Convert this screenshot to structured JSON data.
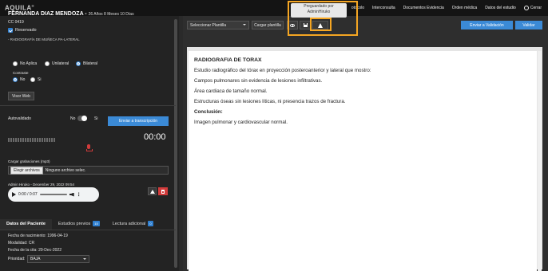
{
  "app": {
    "logo": "AQUILA",
    "logo_mark": "®"
  },
  "nav": {
    "items": [
      "Le",
      "otocolo",
      "Interconsulta",
      "Documentos Evidencia",
      "Orden médica",
      "Datos del estudio"
    ],
    "logout": "Cerrar"
  },
  "tooltip": {
    "line1": "Preguardado por",
    "line2": "AdminHiruko"
  },
  "patient": {
    "name": "FERNANDA DIAZ MENDOZA -",
    "age": "26 Años 8 Meses 10 Días",
    "cc": "CC 0419",
    "reserved_label": "Reservado",
    "study": "- RADIOGRAFÍA DE MUÑECA PA-LATERAL",
    "laterality": {
      "options": [
        "No Aplica",
        "Unilateral",
        "Bilateral"
      ],
      "selected": "Bilateral"
    },
    "contrast_label": "Contraste",
    "contrast": {
      "options": [
        "No",
        "Si"
      ],
      "selected": "No"
    },
    "view_web": "Visor Web"
  },
  "dictation": {
    "autovalidado": "Autovalidado",
    "no": "No",
    "si": "Si",
    "transcribe_button": "Enviar a transcripción",
    "timer": "00:00",
    "upload_label": "Cargar grabaciones (mp3)",
    "choose_file": "Elegir archivos",
    "no_file": "Ninguno archivo selec.",
    "audio_meta": "Admin Hiruko - December 29, 2022 09:54",
    "audio_time": "0:00 / 0:07"
  },
  "patient_tabs": [
    {
      "label": "Datos del Paciente",
      "active": true,
      "badge": ""
    },
    {
      "label": "Estudios previos",
      "active": false,
      "badge": "15"
    },
    {
      "label": "Lectura adicional",
      "active": false,
      "badge": "0"
    }
  ],
  "patient_info": {
    "birth": "Fecha de nacimiento: 1996-04-19",
    "modality": "Modalidad: CR",
    "appointment": "Fecha de la cita: 29-Dec-2022",
    "priority_label": "Prioridad:",
    "priority_value": "BAJA"
  },
  "toolbar": {
    "template_select": "Seleccionar Plantilla",
    "load_template": "Cargar plantilla",
    "send_validation": "Enviar a Validación",
    "validate": "Validar"
  },
  "report": {
    "title": "RADIOGRAFIA DE TORAX",
    "lines": [
      "Estudio radiográfico del tórax en proyección posteroanterior y lateral que mostro:",
      "Campos pulmonares sin evidencia de lesiones infiltrativas.",
      "Área cardiaca de tamaño normal.",
      "Estructuras óseas sin lesiones líticas, ni presencia trazos de fractura."
    ],
    "conclusion_label": "Conclusión:",
    "conclusion": "Imagen pulmonar y cardiovascular normal."
  },
  "colors": {
    "accent": "#3b8ad6",
    "danger": "#d23b3b",
    "highlight": "#f5a623"
  }
}
